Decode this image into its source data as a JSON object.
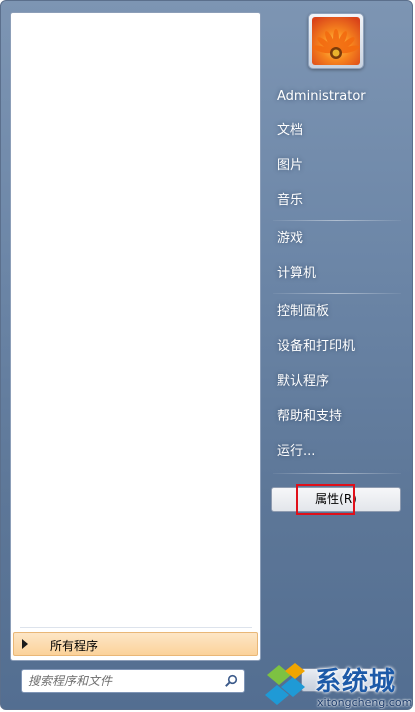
{
  "user": {
    "name": "Administrator"
  },
  "right_menu": {
    "items": [
      {
        "label": "文档"
      },
      {
        "label": "图片"
      },
      {
        "label": "音乐"
      },
      {
        "label": "游戏"
      },
      {
        "label": "计算机"
      },
      {
        "label": "控制面板"
      },
      {
        "label": "设备和打印机"
      },
      {
        "label": "默认程序"
      },
      {
        "label": "帮助和支持"
      },
      {
        "label": "运行..."
      }
    ]
  },
  "properties_button": {
    "label": "属性(R)"
  },
  "all_programs": {
    "label": "所有程序"
  },
  "search": {
    "placeholder": "搜索程序和文件"
  },
  "watermark": {
    "title": "系统城",
    "url": "xitongcheng.com"
  },
  "colors": {
    "highlight_box": "#e0101a",
    "menu_background": "#6d87a8",
    "all_programs_background": "#fbd29a"
  }
}
